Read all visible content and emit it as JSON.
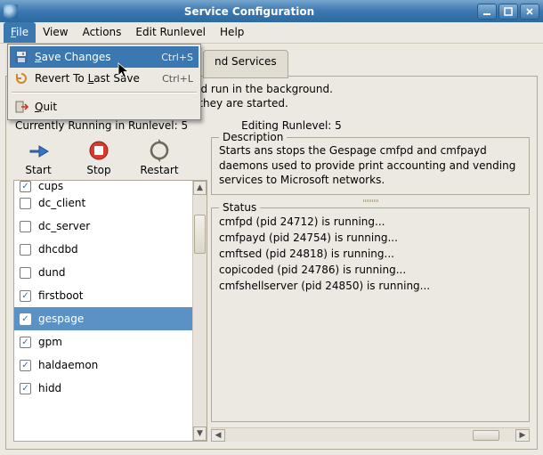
{
  "window": {
    "title": "Service Configuration",
    "icon": "service-config-icon"
  },
  "menubar": {
    "items": [
      {
        "label": "File",
        "mnemonic": "F",
        "open": true
      },
      {
        "label": "View",
        "mnemonic": "V"
      },
      {
        "label": "Actions",
        "mnemonic": "A"
      },
      {
        "label": "Edit Runlevel",
        "mnemonic": "E"
      },
      {
        "label": "Help",
        "mnemonic": "H"
      }
    ]
  },
  "file_menu": {
    "items": [
      {
        "icon": "floppy-icon",
        "label": "Save Changes",
        "mnemonic": "S",
        "accel": "Ctrl+S",
        "highlighted": true
      },
      {
        "icon": "revert-icon",
        "label": "Revert To Last Save",
        "mnemonic": "L",
        "accel": "Ctrl+L"
      }
    ],
    "quit": {
      "icon": "exit-icon",
      "label": "Quit",
      "mnemonic": "Q"
    }
  },
  "tabs": {
    "visible_partial_label": "nd Services",
    "hidden_active_label": "Background Services"
  },
  "intro": {
    "line1": "These services are started once and run in the background.",
    "line2": "You can specify in which runlevels they are started."
  },
  "running": {
    "label": "Currently Running in Runlevel:",
    "value": "5"
  },
  "editing": {
    "label": "Editing Runlevel:",
    "value": "5"
  },
  "toolbar": {
    "start": {
      "icon": "arrow-right-icon",
      "label": "Start"
    },
    "stop": {
      "icon": "stop-icon",
      "label": "Stop"
    },
    "restart": {
      "icon": "reload-icon",
      "label": "Restart"
    }
  },
  "services": [
    {
      "name": "cups",
      "checked": true,
      "cutoff": true
    },
    {
      "name": "dc_client",
      "checked": false
    },
    {
      "name": "dc_server",
      "checked": false
    },
    {
      "name": "dhcdbd",
      "checked": false
    },
    {
      "name": "dund",
      "checked": false
    },
    {
      "name": "firstboot",
      "checked": true
    },
    {
      "name": "gespage",
      "checked": true,
      "selected": true
    },
    {
      "name": "gpm",
      "checked": true
    },
    {
      "name": "haldaemon",
      "checked": true
    },
    {
      "name": "hidd",
      "checked": true
    }
  ],
  "description": {
    "legend": "Description",
    "text": "Starts ans stops the Gespage cmfpd and cmfpayd daemons used to provide print accounting and vending services to Microsoft networks."
  },
  "status": {
    "legend": "Status",
    "lines": [
      "cmfpd (pid 24712) is running...",
      "cmfpayd (pid 24754) is running...",
      "cmftsed (pid 24818) is running...",
      "copicoded (pid 24786) is running...",
      "cmfshellserver (pid 24850) is running..."
    ]
  },
  "colors": {
    "accent": "#3b77b0",
    "selection": "#5b92c6"
  }
}
